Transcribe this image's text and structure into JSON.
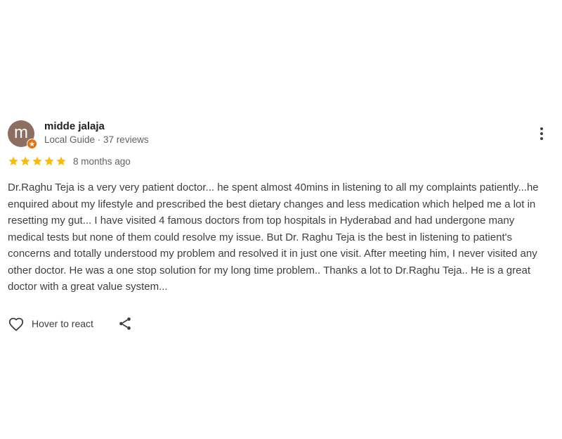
{
  "review": {
    "author": {
      "avatar_letter": "m",
      "avatar_color": "#8d6e63",
      "badge_icon": "local-guide-star-icon",
      "name": "midde jalaja",
      "meta": "Local Guide · 37 reviews"
    },
    "rating": 5,
    "rating_max": 5,
    "star_color": "#fbbc04",
    "date": "8 months ago",
    "text": "Dr.Raghu Teja is a very very patient doctor... he spent almost 40mins in listening to all my complaints patiently...he enquired about my lifestyle and prescribed the best dietary changes and less medication which helped me a lot in resetting my gut... I have visited 4 famous doctors from top hospitals in Hyderabad and had undergone many medical tests but none of them could resolve my issue. But Dr. Raghu Teja is the best in listening to patient's concerns and totally understood my problem and resolved it in just one visit. After meeting him, I never visited any other doctor. He was a one stop solution for my long time problem.. Thanks a lot to Dr.Raghu Teja.. He is a great doctor with a great value system...",
    "actions": {
      "react_icon": "heart-outline-icon",
      "react_label": "Hover to react",
      "share_icon": "share-icon",
      "more_icon": "more-vertical-icon"
    }
  }
}
